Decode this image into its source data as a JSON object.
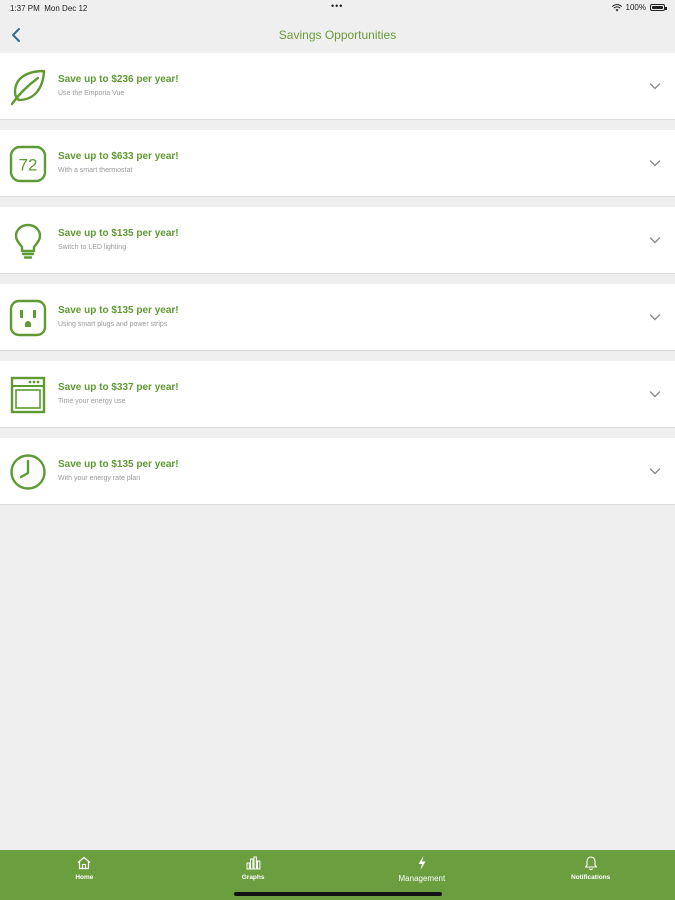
{
  "status_bar": {
    "time": "1:37 PM",
    "date": "Mon Dec 12",
    "dots": "•••",
    "battery_text": "100%",
    "wifi_icon": "wifi-icon",
    "battery_icon": "battery-icon"
  },
  "nav": {
    "title": "Savings Opportunities",
    "back_icon": "chevron-left-icon"
  },
  "colors": {
    "accent": "#5f9a32",
    "tab_bar": "#6a9e3f",
    "background": "#efefef"
  },
  "opportunities": [
    {
      "icon": "leaf-icon",
      "title": "Save up to $236 per year!",
      "subtitle": "Use the Emporia Vue"
    },
    {
      "icon": "thermostat-icon",
      "title": "Save up to $633 per year!",
      "subtitle": "With a smart thermostat",
      "icon_text": "72"
    },
    {
      "icon": "lightbulb-icon",
      "title": "Save up to $135 per year!",
      "subtitle": "Switch to LED lighting"
    },
    {
      "icon": "outlet-icon",
      "title": "Save up to $135 per year!",
      "subtitle": "Using smart plugs and power strips"
    },
    {
      "icon": "appliance-icon",
      "title": "Save up to $337 per year!",
      "subtitle": "Time your energy use"
    },
    {
      "icon": "clock-icon",
      "title": "Save up to $135 per year!",
      "subtitle": "With your energy rate plan"
    }
  ],
  "tabs": [
    {
      "label": "Home",
      "icon": "home-icon",
      "active": false
    },
    {
      "label": "Graphs",
      "icon": "bar-chart-icon",
      "active": false
    },
    {
      "label": "Management",
      "icon": "lightning-icon",
      "active": true
    },
    {
      "label": "Notifications",
      "icon": "bell-icon",
      "active": false
    }
  ]
}
